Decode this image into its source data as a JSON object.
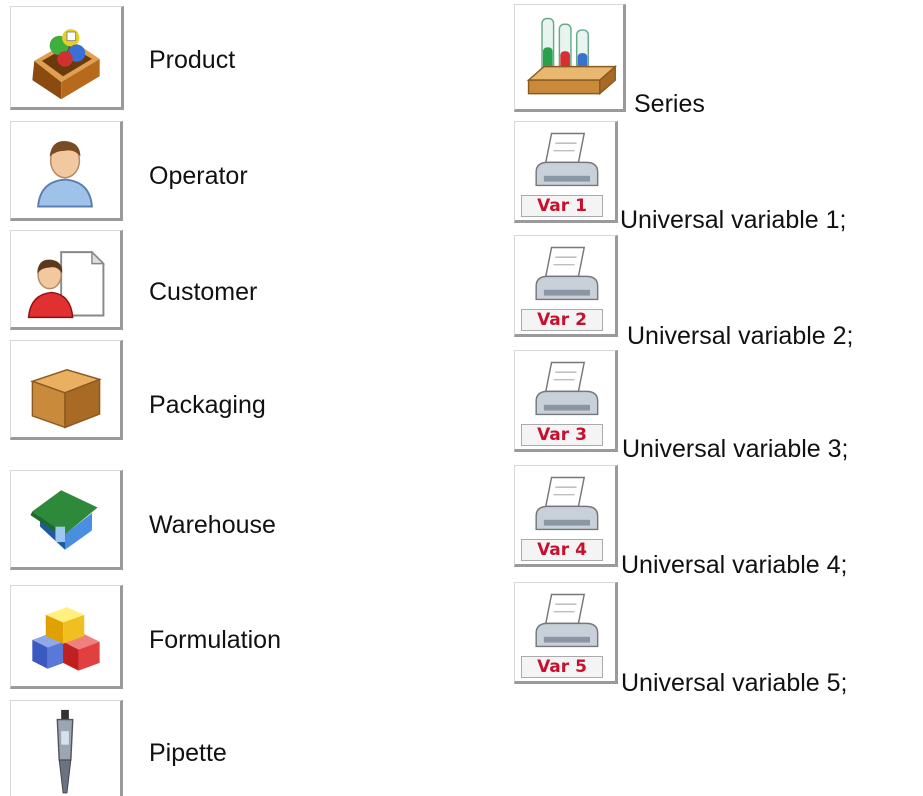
{
  "left_items": [
    {
      "label": "Product",
      "icon": "product-box-icon"
    },
    {
      "label": "Operator",
      "icon": "operator-person-icon"
    },
    {
      "label": "Customer",
      "icon": "customer-person-document-icon"
    },
    {
      "label": "Packaging",
      "icon": "packaging-box-icon"
    },
    {
      "label": "Warehouse",
      "icon": "warehouse-house-icon"
    },
    {
      "label": "Formulation",
      "icon": "formulation-cubes-icon"
    },
    {
      "label": "Pipette",
      "icon": "pipette-icon"
    }
  ],
  "right_items": [
    {
      "label": "Series",
      "icon": "series-test-tubes-icon"
    },
    {
      "label": "Universal variable 1;",
      "icon": "printer-icon",
      "badge": "Var 1"
    },
    {
      "label": "Universal variable 2;",
      "icon": "printer-icon",
      "badge": "Var 2"
    },
    {
      "label": "Universal variable 3;",
      "icon": "printer-icon",
      "badge": "Var 3"
    },
    {
      "label": "Universal variable 4;",
      "icon": "printer-icon",
      "badge": "Var 4"
    },
    {
      "label": "Universal variable 5;",
      "icon": "printer-icon",
      "badge": "Var 5"
    }
  ],
  "colors": {
    "badge_text": "#c8102e",
    "tile_shadow": "#9a9a9a"
  }
}
